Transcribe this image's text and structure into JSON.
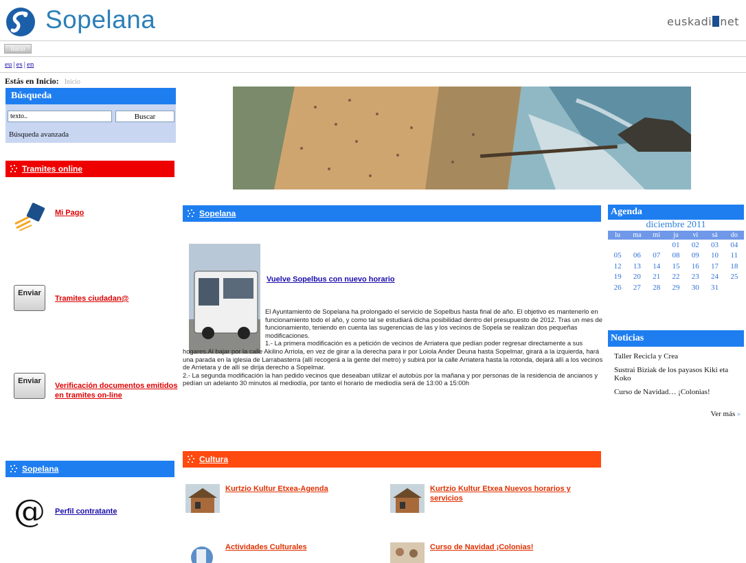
{
  "header": {
    "site_name": "Sopelana",
    "brand_left": "euskadi",
    "brand_right": "net"
  },
  "nav": {
    "home_button": "Inicio"
  },
  "languages": [
    "eu",
    "es",
    "en"
  ],
  "breadcrumb": {
    "label": "Estás en Inicio:",
    "link": "Inicio"
  },
  "search": {
    "title": "Búsqueda",
    "input_value": "texto..",
    "button_label": "Buscar",
    "advanced_link": "Búsqueda avanzada"
  },
  "tramites": {
    "bar_title": "Tramites online",
    "items": [
      {
        "label": "Mi Pago",
        "icon": "payment-card-icon"
      },
      {
        "label": "Tramites ciudadan@",
        "icon": "send-button-icon",
        "icon_text": "Enviar"
      },
      {
        "label": "Verificación documentos emitidos en tramites on-line",
        "icon": "send-button-icon",
        "icon_text": "Enviar"
      }
    ]
  },
  "left_sopelana": {
    "bar_title": "Sopelana",
    "perfil_label": "Perfil contratante",
    "perfil_icon": "at-sign-icon"
  },
  "main": {
    "bar_title": "Sopelana",
    "news_title": "Vuelve Sopelbus con nuevo horario",
    "news_paragraphs": [
      "El Ayuntamiento de Sopelana ha prolongado el servicio de Sopelbus hasta final de año. El objetivo es mantenerlo en funcionamiento todo el año, y como tal se estudiará dicha posibilidad dentro del presupuesto de 2012. Tras un mes de funcionamiento, teniendo en cuenta las sugerencias de las y los vecinos de Sopela se realizan dos pequeñas modificaciones.",
      "1.- La primera modificación es a petición de vecinos de Arriatera que pedían poder regresar directamente a sus hogares.Al bajar por la calle Akilino Arriola, en vez de girar a la derecha para ir por Loiola Ander Deuna hasta Sopelmar, girará a la izquierda, hará una parada en la iglesia de Larrabasterra (allí recogerá a la gente del metro) y subirá por la calle Arriatera hasta la rotonda, dejará allí a los vecinos de Arrietara y de allí se dirija derecho a Sopelmar.",
      "2.- La segunda modificación la han pedido vecinos que deseaban utilizar el autobús por la mañana y por personas de la residencia de ancianos y pedían un adelanto 30 minutos al mediodía, por tanto el horario de mediodía será de 13:00 a 15:00h"
    ]
  },
  "cultura": {
    "bar_title": "Cultura",
    "items": [
      "Kurtzio Kultur Etxea-Agenda",
      "Kurtzio Kultur Etxea Nuevos horarios y servicios",
      "Actividades Culturales",
      "Curso de Navidad ¡Colonias!"
    ]
  },
  "agenda": {
    "title": "Agenda",
    "month": "diciembre 2011",
    "weekdays": [
      "lu",
      "ma",
      "mi",
      "ju",
      "vi",
      "sá",
      "do"
    ],
    "weeks": [
      [
        "",
        "",
        "",
        "01",
        "02",
        "03",
        "04"
      ],
      [
        "05",
        "06",
        "07",
        "08",
        "09",
        "10",
        "11"
      ],
      [
        "12",
        "13",
        "14",
        "15",
        "16",
        "17",
        "18"
      ],
      [
        "19",
        "20",
        "21",
        "22",
        "23",
        "24",
        "25"
      ],
      [
        "26",
        "27",
        "28",
        "29",
        "30",
        "31",
        ""
      ]
    ]
  },
  "noticias": {
    "title": "Noticias",
    "items": [
      "Taller Recicla y Crea",
      "Sustrai Biziak de los payasos Kiki eta Koko",
      "Curso de Navidad… ¡Colonias!"
    ],
    "more": "Ver más",
    "more_arrow": "»"
  }
}
